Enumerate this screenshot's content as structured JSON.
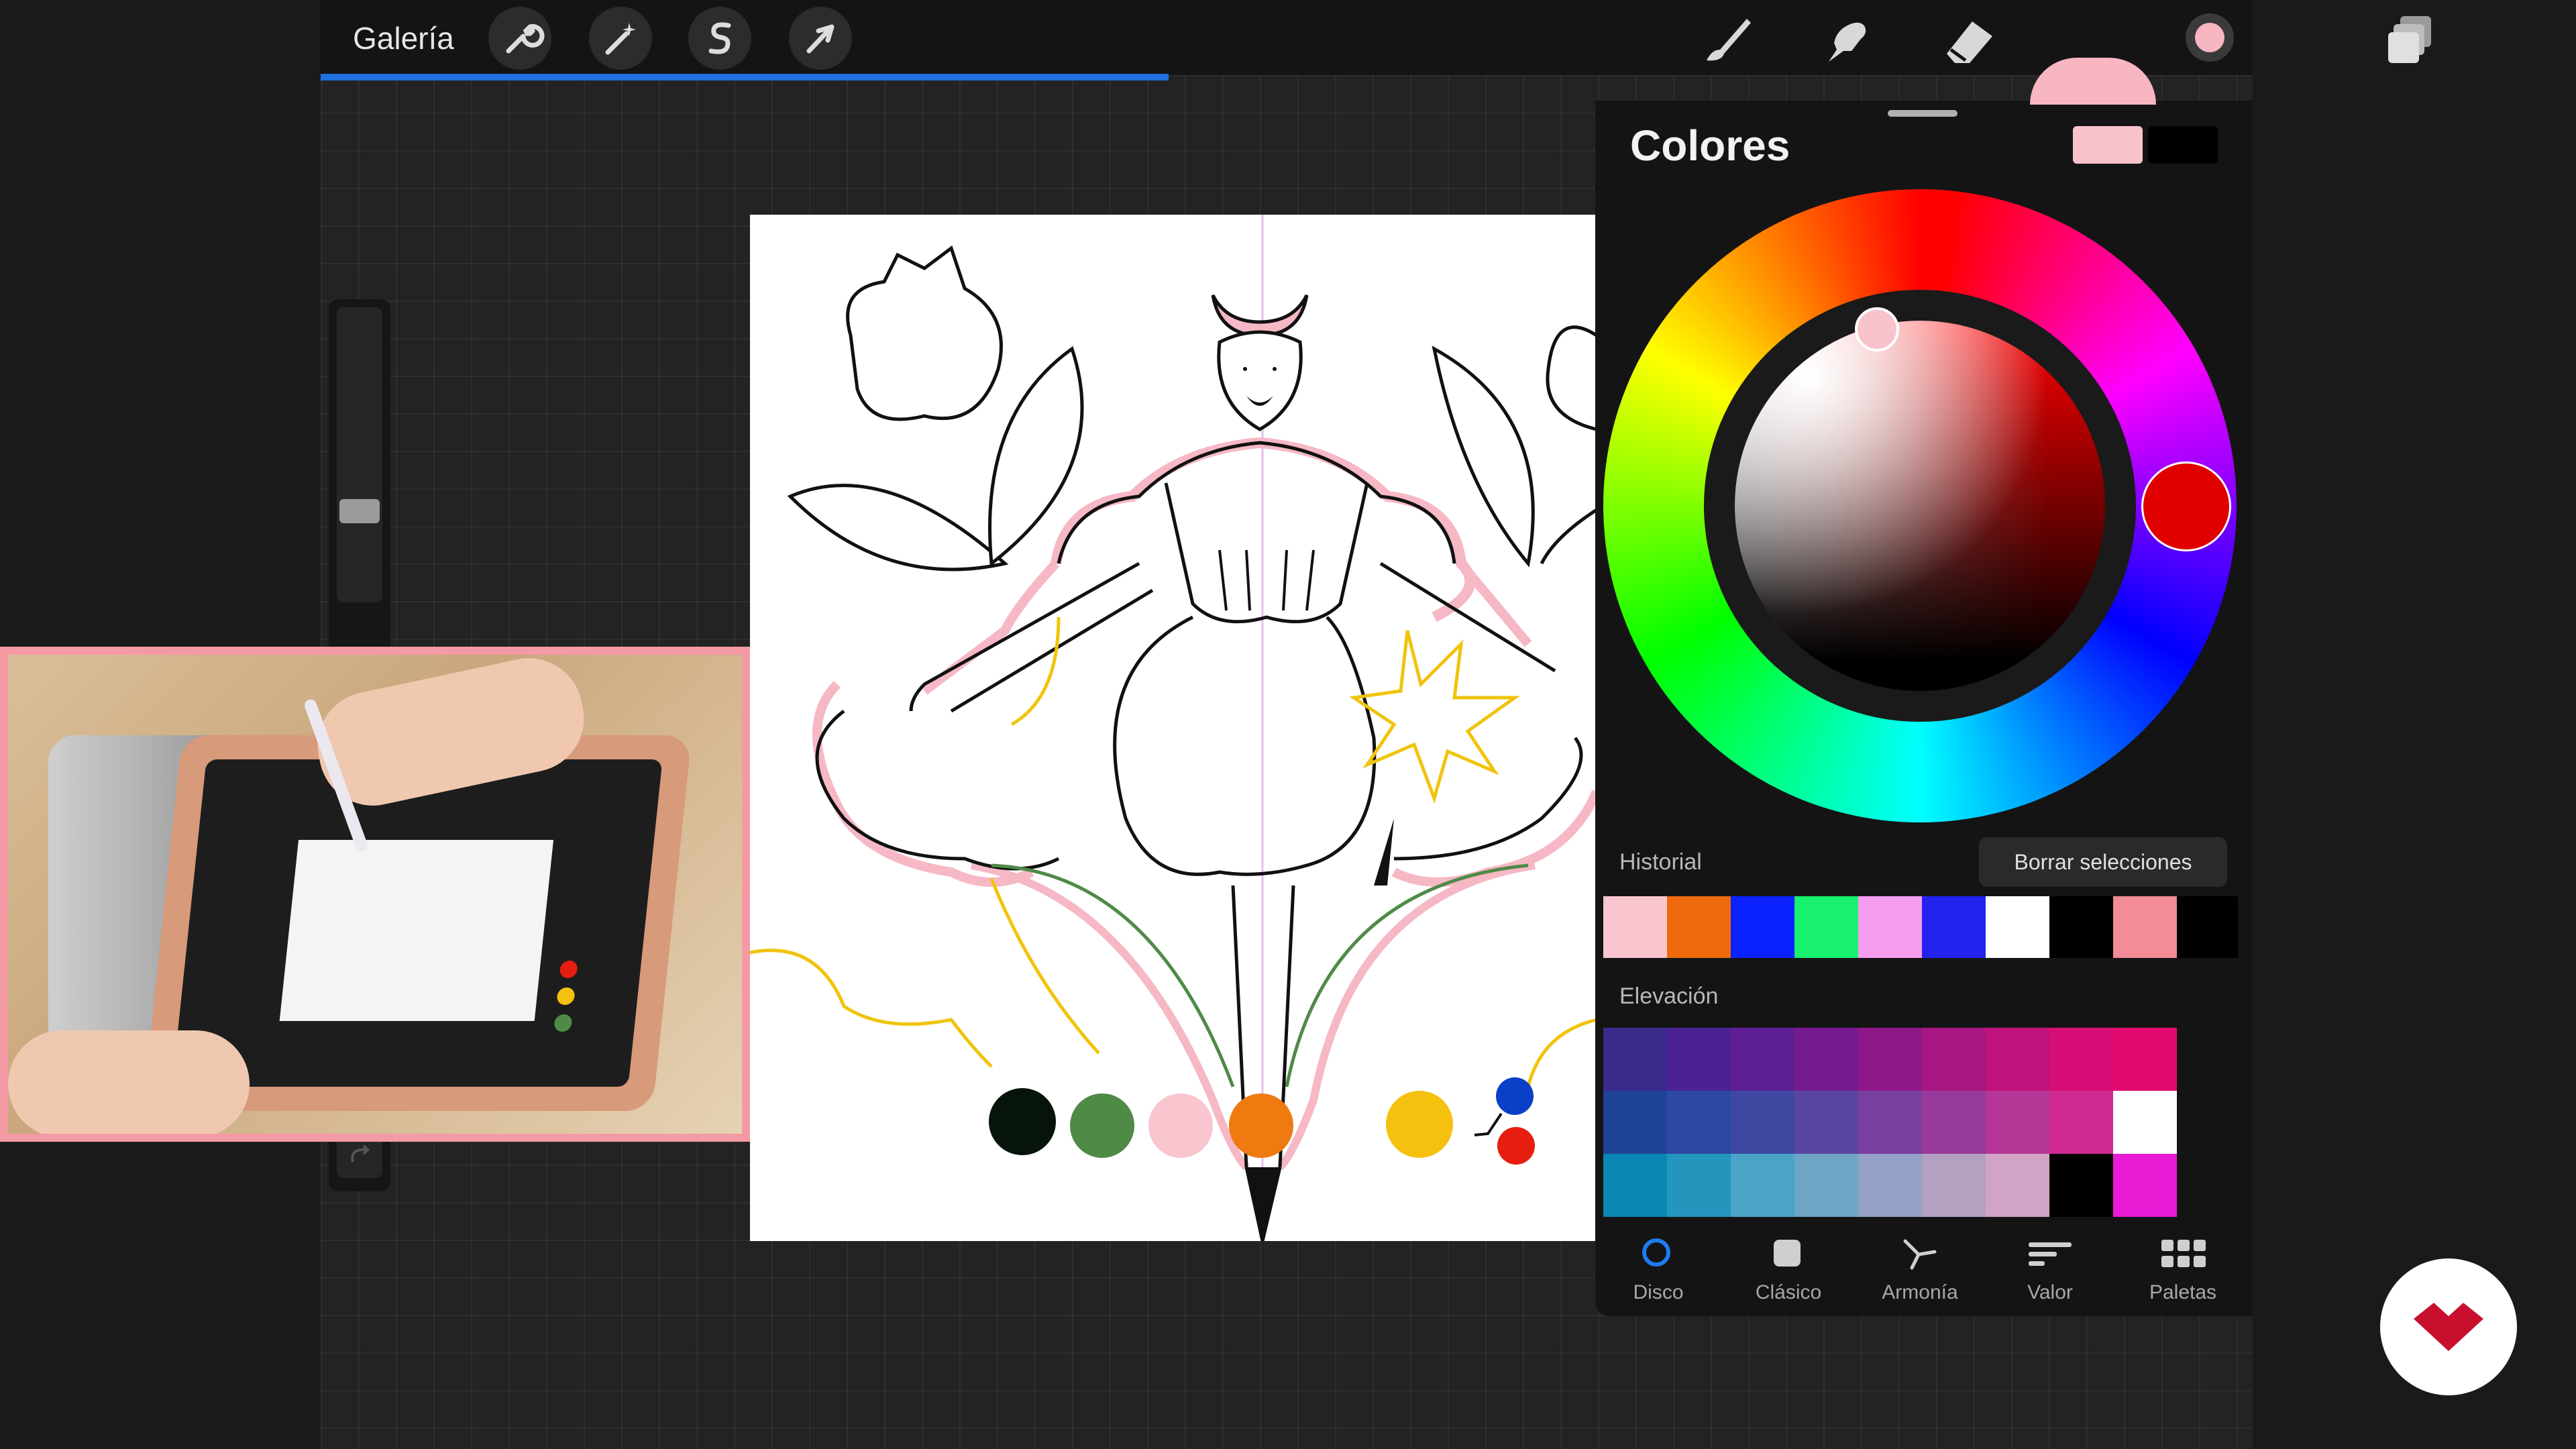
{
  "toolbar": {
    "gallery_label": "Galería",
    "left_tools": [
      "wrench-icon",
      "magic-wand-icon",
      "selection-s-icon",
      "arrow-transform-icon"
    ],
    "right_tools": [
      "brush-icon",
      "smudge-icon",
      "eraser-icon",
      "layers-icon",
      "color-dot-icon"
    ],
    "active_color": "#f7b6c2"
  },
  "colors_panel": {
    "title": "Colores",
    "current_color": "#f9c3cb",
    "previous_color": "#000000",
    "history_label": "Historial",
    "clear_button_label": "Borrar selecciones",
    "history_swatches": [
      "#f9c6d0",
      "#ef6a0c",
      "#0a22ff",
      "#18f06e",
      "#f59ef0",
      "#2323f0",
      "#ffffff",
      "#000000",
      "#f28c96",
      "#000000"
    ],
    "palette_label": "Elevación",
    "palette_rows": [
      [
        "#3a2a8c",
        "#4b2294",
        "#5e1e94",
        "#761a8f",
        "#8e1888",
        "#a81682",
        "#c0127c",
        "#d60e76",
        "#e20a70",
        "#141414"
      ],
      [
        "#1f4496",
        "#2c48a0",
        "#3e48a0",
        "#5a46a0",
        "#7a3ea0",
        "#983a9c",
        "#b43696",
        "#ce2a90",
        "#ffffff",
        "#141414"
      ],
      [
        "#0a88b4",
        "#2496be",
        "#4aa4c8",
        "#6ea4c6",
        "#94a0c6",
        "#b4a0c0",
        "#d0a4c4",
        "#ffffff",
        "#000000",
        "#e91ad4"
      ]
    ],
    "tabs": [
      {
        "label": "Disco",
        "icon": "disc-icon"
      },
      {
        "label": "Clásico",
        "icon": "square-icon"
      },
      {
        "label": "Armonía",
        "icon": "harmony-icon"
      },
      {
        "label": "Valor",
        "icon": "sliders-icon"
      },
      {
        "label": "Paletas",
        "icon": "grid-icon"
      }
    ],
    "active_tab": "Disco"
  },
  "canvas_colors": [
    "#06140a",
    "#4f8a47",
    "#f9c6d0",
    "#ef7a10",
    "#f5c10e",
    "#0a3fc8",
    "#e61e0f"
  ],
  "brand": "domestika-logo"
}
